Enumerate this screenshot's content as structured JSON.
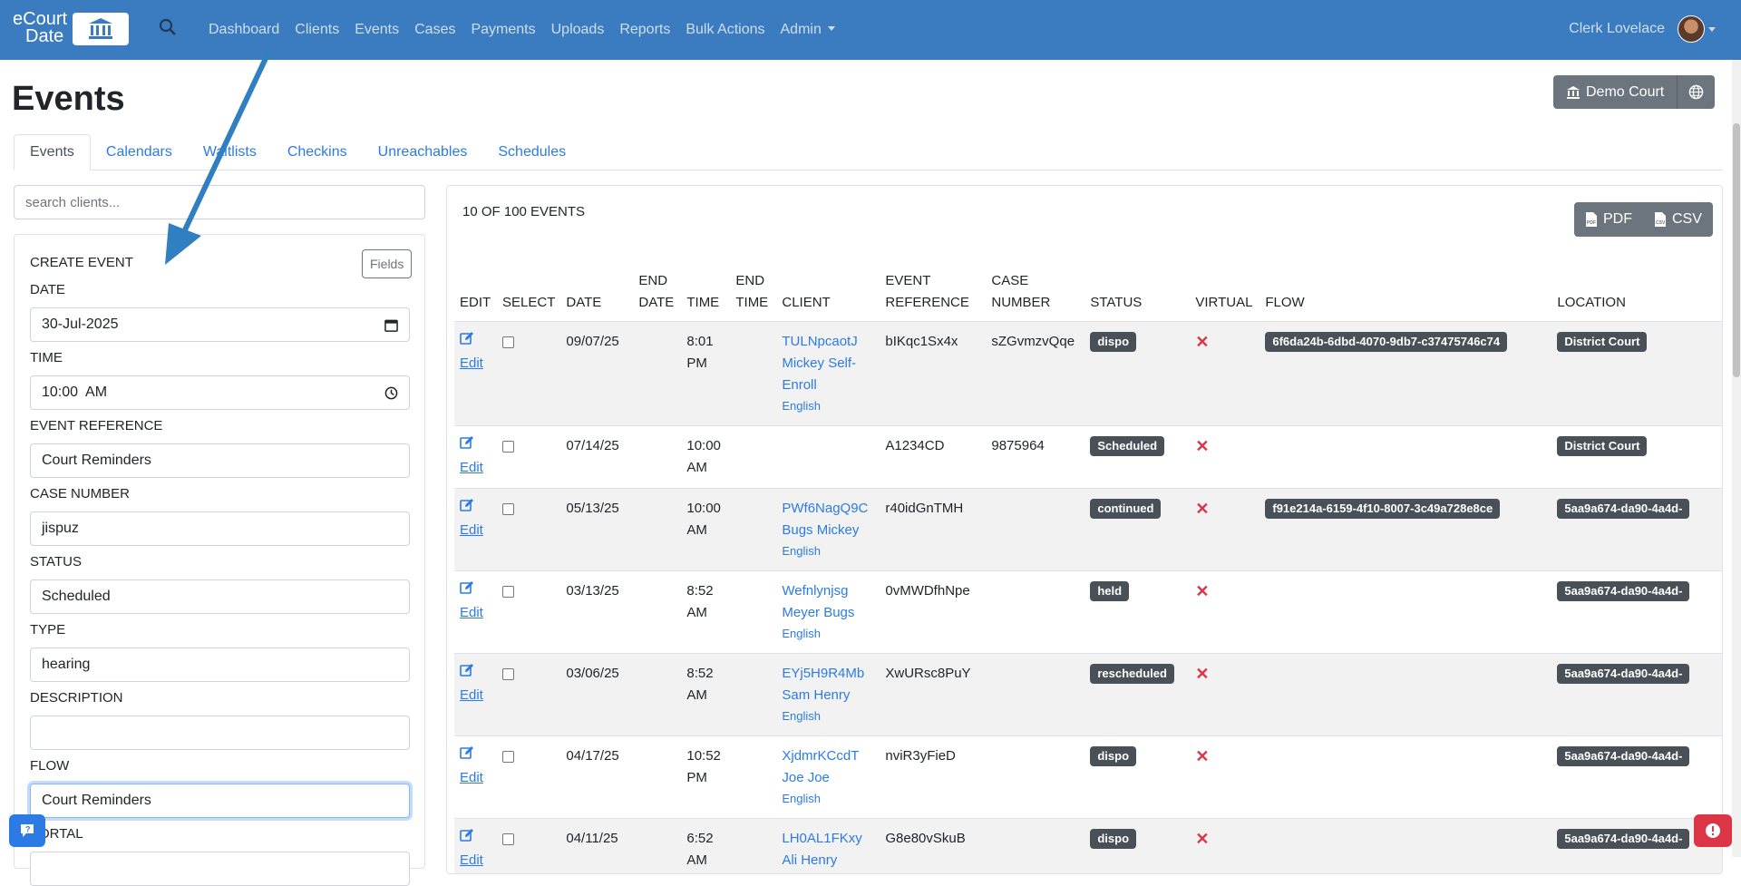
{
  "navbar": {
    "brand_line1": "eCourt",
    "brand_line2": "Date",
    "links": [
      "Dashboard",
      "Clients",
      "Events",
      "Cases",
      "Payments",
      "Uploads",
      "Reports",
      "Bulk Actions",
      "Admin"
    ],
    "user_name": "Clerk Lovelace"
  },
  "header": {
    "title": "Events",
    "court_button": "Demo Court"
  },
  "tabs": [
    "Events",
    "Calendars",
    "Waitlists",
    "Checkins",
    "Unreachables",
    "Schedules"
  ],
  "search": {
    "placeholder": "search clients..."
  },
  "create_event": {
    "title": "CREATE EVENT",
    "fields_button": "Fields",
    "date_label": "DATE",
    "date_value": "30-Jul-2025",
    "time_label": "TIME",
    "time_value": "10:00  AM",
    "event_reference_label": "EVENT REFERENCE",
    "event_reference_value": "Court Reminders",
    "case_number_label": "CASE NUMBER",
    "case_number_value": "jispuz",
    "status_label": "STATUS",
    "status_value": "Scheduled",
    "type_label": "TYPE",
    "type_value": "hearing",
    "description_label": "DESCRIPTION",
    "description_value": "",
    "flow_label": "FLOW",
    "flow_value": "Court Reminders",
    "portal_label": "PORTAL"
  },
  "events_list": {
    "count": "10 OF 100 EVENTS",
    "pdf_button": "PDF",
    "csv_button": "CSV",
    "columns": {
      "edit": "EDIT",
      "select": "SELECT",
      "date": "DATE",
      "end_date_1": "END",
      "end_date_2": "DATE",
      "time": "TIME",
      "end_time_1": "END",
      "end_time_2": "TIME",
      "client": "CLIENT",
      "event_ref_1": "EVENT",
      "event_ref_2": "REFERENCE",
      "case_1": "CASE",
      "case_2": "NUMBER",
      "status": "STATUS",
      "virtual": "VIRTUAL",
      "flow": "FLOW",
      "location": "LOCATION"
    },
    "edit_label": "Edit",
    "rows": [
      {
        "date": "09/07/25",
        "time1": "8:01",
        "time2": "PM",
        "client_id": "TULNpcaotJ",
        "client_name1": "Mickey Self-",
        "client_name2": "Enroll",
        "lang": "English",
        "event_ref": "bIKqc1Sx4x",
        "case": "sZGvmzvQqe",
        "status": "dispo",
        "virtual": "✕",
        "flow": "6f6da24b-6dbd-4070-9db7-c37475746c74",
        "location": "District Court"
      },
      {
        "date": "07/14/25",
        "time1": "10:00",
        "time2": "AM",
        "client_id": "",
        "client_name1": "",
        "client_name2": "",
        "lang": "",
        "event_ref": "A1234CD",
        "case": "9875964",
        "status": "Scheduled",
        "virtual": "✕",
        "flow": "",
        "location": "District Court"
      },
      {
        "date": "05/13/25",
        "time1": "10:00",
        "time2": "AM",
        "client_id": "PWf6NagQ9C",
        "client_name1": "Bugs Mickey",
        "client_name2": "",
        "lang": "English",
        "event_ref": "r40idGnTMH",
        "case": "",
        "status": "continued",
        "virtual": "✕",
        "flow": "f91e214a-6159-4f10-8007-3c49a728e8ce",
        "location": "5aa9a674-da90-4a4d-"
      },
      {
        "date": "03/13/25",
        "time1": "8:52",
        "time2": "AM",
        "client_id": "Wefnlynjsg",
        "client_name1": "Meyer Bugs",
        "client_name2": "",
        "lang": "English",
        "event_ref": "0vMWDfhNpe",
        "case": "",
        "status": "held",
        "virtual": "✕",
        "flow": "",
        "location": "5aa9a674-da90-4a4d-"
      },
      {
        "date": "03/06/25",
        "time1": "8:52",
        "time2": "AM",
        "client_id": "EYj5H9R4Mb",
        "client_name1": "Sam Henry",
        "client_name2": "",
        "lang": "English",
        "event_ref": "XwURsc8PuY",
        "case": "",
        "status": "rescheduled",
        "virtual": "✕",
        "flow": "",
        "location": "5aa9a674-da90-4a4d-"
      },
      {
        "date": "04/17/25",
        "time1": "10:52",
        "time2": "PM",
        "client_id": "XjdmrKCcdT",
        "client_name1": "Joe Joe",
        "client_name2": "",
        "lang": "English",
        "event_ref": "nviR3yFieD",
        "case": "",
        "status": "dispo",
        "virtual": "✕",
        "flow": "",
        "location": "5aa9a674-da90-4a4d-"
      },
      {
        "date": "04/11/25",
        "time1": "6:52",
        "time2": "AM",
        "client_id": "LH0AL1FKxy",
        "client_name1": "Ali Henry",
        "client_name2": "",
        "lang": "",
        "event_ref": "G8e80vSkuB",
        "case": "",
        "status": "dispo",
        "virtual": "✕",
        "flow": "",
        "location": "5aa9a674-da90-4a4d-"
      }
    ]
  },
  "colors": {
    "navbar": "#3b7bbf",
    "link": "#2c7be5",
    "badge": "#495057",
    "danger": "#dc3545",
    "arrow": "#2f7fc1"
  }
}
